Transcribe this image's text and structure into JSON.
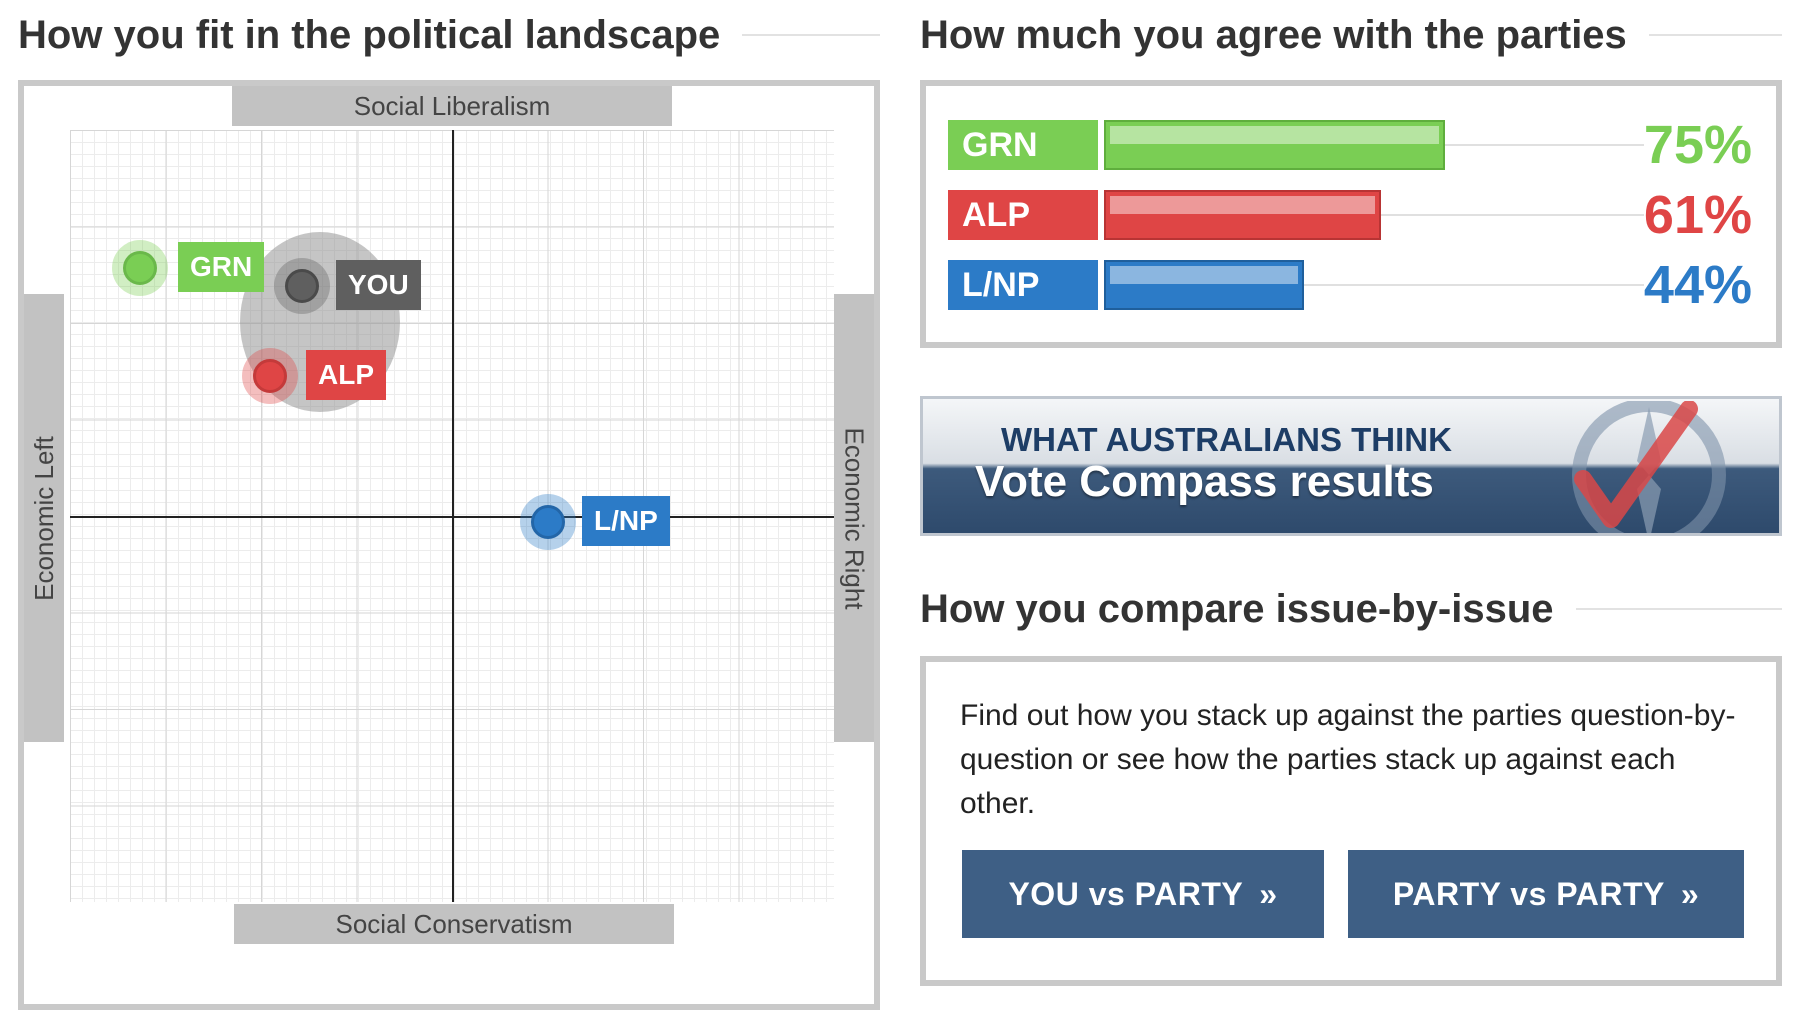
{
  "landscape": {
    "title": "How you fit in the political landscape",
    "axes": {
      "top": "Social Liberalism",
      "bottom": "Social Conservatism",
      "left": "Economic Left",
      "right": "Economic Right"
    },
    "markers": [
      {
        "id": "grn",
        "label": "GRN",
        "color": "#7ace54"
      },
      {
        "id": "you",
        "label": "YOU",
        "color": "#5f5f5f"
      },
      {
        "id": "alp",
        "label": "ALP",
        "color": "#df4545"
      },
      {
        "id": "lnp",
        "label": "L/NP",
        "color": "#2c7bc7"
      }
    ]
  },
  "agreement": {
    "title": "How much you agree with the parties",
    "parties": [
      {
        "name": "GRN",
        "percent_label": "75%",
        "value": 75,
        "color": "#7ace54"
      },
      {
        "name": "ALP",
        "percent_label": "61%",
        "value": 61,
        "color": "#df4545"
      },
      {
        "name": "L/NP",
        "percent_label": "44%",
        "value": 44,
        "color": "#2c7bc7"
      }
    ]
  },
  "banner": {
    "line1": "WHAT AUSTRALIANS THINK",
    "line2": "Vote Compass results"
  },
  "compare": {
    "title": "How you compare issue-by-issue",
    "text": "Find out how you stack up against the parties question-by-question or see how the parties stack up against each other.",
    "buttons": [
      {
        "label": "YOU vs PARTY",
        "arrows": "»"
      },
      {
        "label": "PARTY vs PARTY",
        "arrows": "»"
      }
    ]
  }
}
